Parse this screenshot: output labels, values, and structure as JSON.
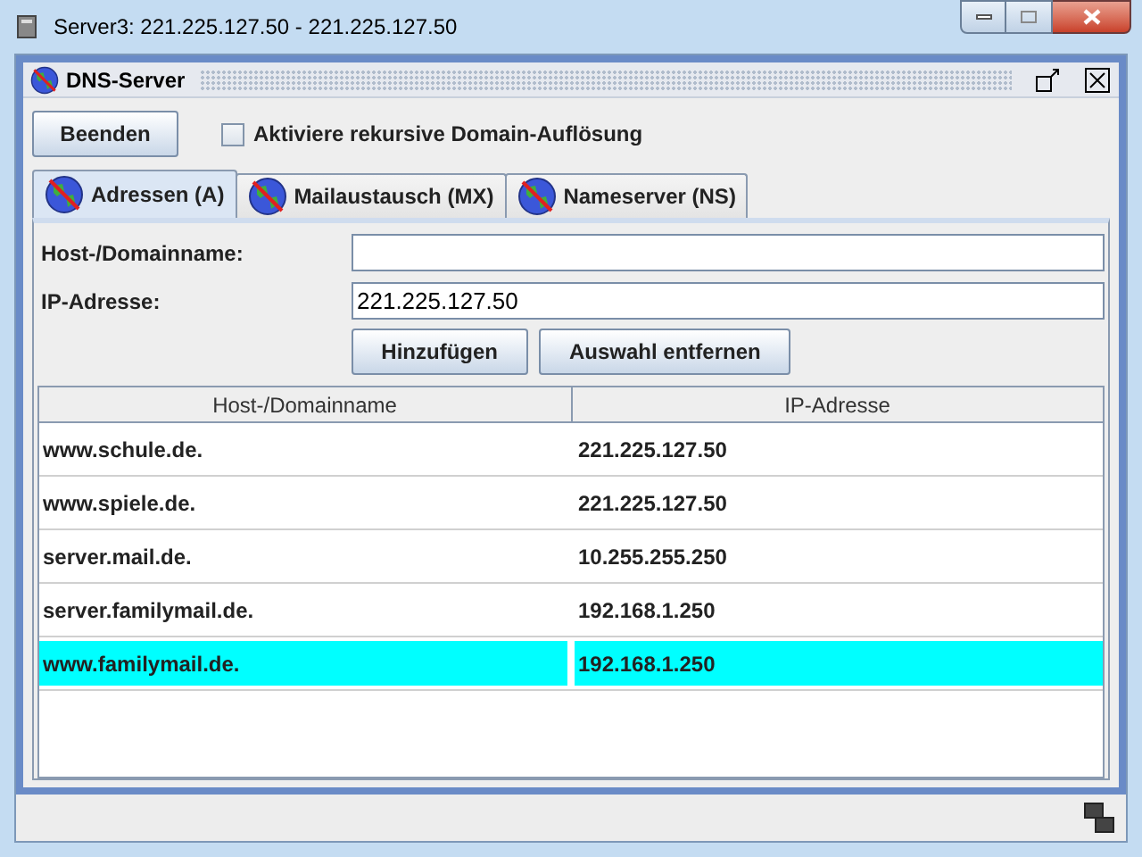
{
  "window": {
    "title": "Server3: 221.225.127.50 - 221.225.127.50"
  },
  "frame": {
    "title": "DNS-Server"
  },
  "quit_button": "Beenden",
  "recursive_checkbox": {
    "label": "Aktiviere rekursive Domain-Auflösung",
    "checked": false
  },
  "tabs": [
    {
      "label": "Adressen (A)",
      "selected": true
    },
    {
      "label": "Mailaustausch (MX)",
      "selected": false
    },
    {
      "label": "Nameserver (NS)",
      "selected": false
    }
  ],
  "fields": [
    {
      "label": "Host-/Domainname:"
    },
    {
      "label": "IP-Adresse:",
      "value": "221.225.127.50"
    }
  ],
  "buttons": [
    "Hinzufügen",
    "Auswahl entfernen"
  ],
  "table": {
    "columns": [
      "Host-/Domainname",
      "IP-Adresse"
    ],
    "rows": [
      {
        "cells": [
          "www.schule.de.",
          "221.225.127.50"
        ],
        "selected": false
      },
      {
        "cells": [
          "www.spiele.de.",
          "221.225.127.50"
        ],
        "selected": false
      },
      {
        "cells": [
          "server.mail.de.",
          "10.255.255.250"
        ],
        "selected": false
      },
      {
        "cells": [
          "server.familymail.de.",
          "192.168.1.250"
        ],
        "selected": false
      },
      {
        "cells": [
          "www.familymail.de.",
          "192.168.1.250"
        ],
        "selected": true
      }
    ]
  }
}
